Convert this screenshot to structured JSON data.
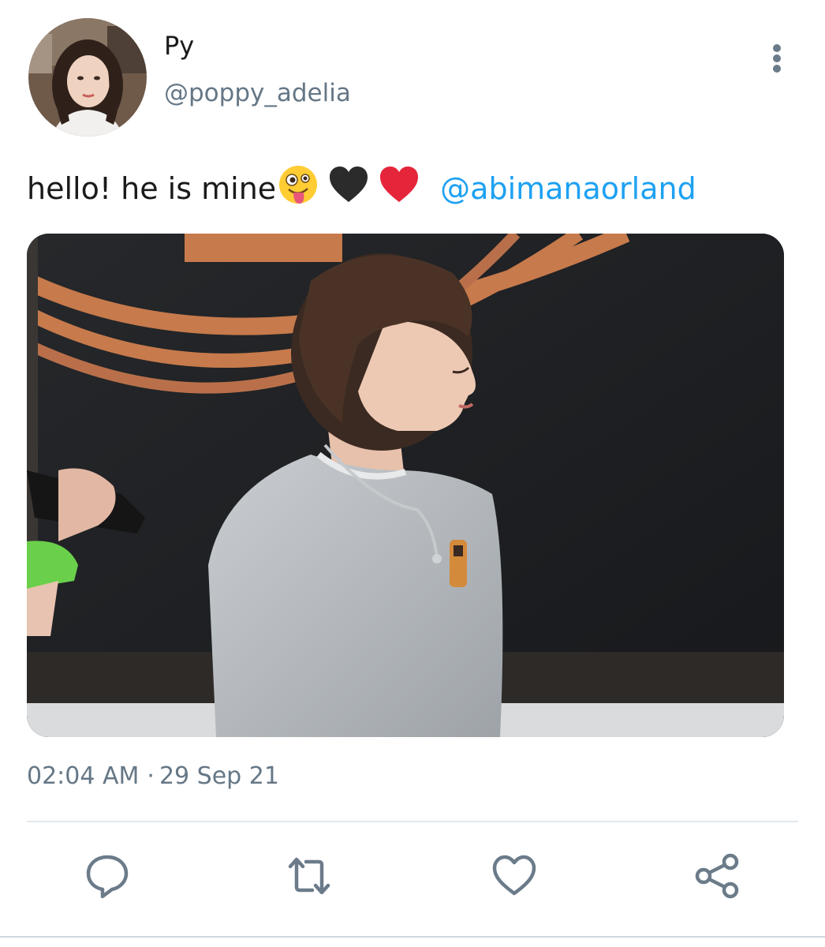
{
  "user": {
    "display_name": "Py",
    "handle": "@poppy_adelia",
    "avatar_icon": "profile-photo"
  },
  "tweet": {
    "text": "hello!  he is mine",
    "emojis": [
      "winking-tongue-face",
      "black-heart",
      "red-heart"
    ],
    "mention": "@abimanaorland",
    "media_icon": "photo-attachment"
  },
  "meta": {
    "time": "02:04 AM",
    "separator": "·",
    "date": "29 Sep 21"
  },
  "actions": [
    {
      "icon": "reply-icon"
    },
    {
      "icon": "retweet-icon"
    },
    {
      "icon": "like-icon"
    },
    {
      "icon": "share-icon"
    }
  ],
  "colors": {
    "mention": "#1da1f2",
    "secondary_text": "#657786",
    "icon": "#6b7b8a"
  }
}
